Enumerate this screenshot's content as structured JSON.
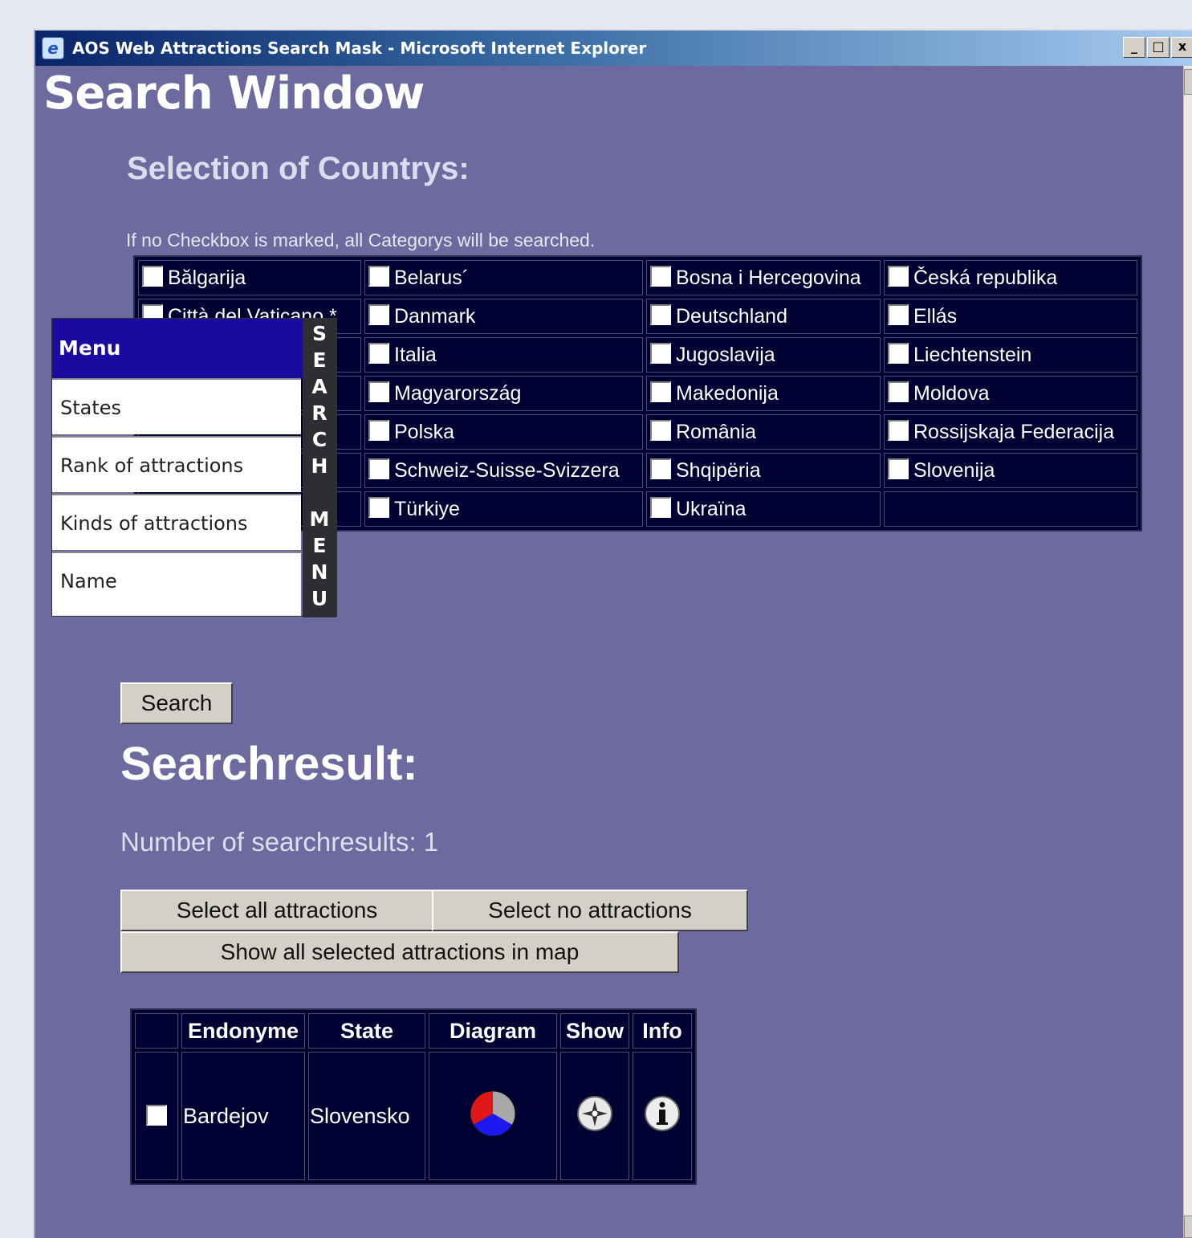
{
  "window": {
    "title": "AOS Web Attractions Search Mask - Microsoft Internet Explorer",
    "controls": [
      "_",
      "□",
      "x"
    ]
  },
  "page": {
    "title": "Search Window",
    "section_title": "Selection of Countrys:",
    "hint": "If no Checkbox is marked, all Categorys will be searched."
  },
  "countries": {
    "rows": [
      [
        "Bălgarija",
        "Belarus´",
        "Bosna i Hercegovina",
        "Česká republika"
      ],
      [
        "Città del Vaticano *",
        "Danmark",
        "Deutschland",
        "Ellás"
      ],
      [
        "",
        "Italia",
        "Jugoslavija",
        "Liechtenstein"
      ],
      [
        "",
        "Magyarország",
        "Makedonija",
        "Moldova"
      ],
      [
        "",
        "Polska",
        "România",
        "Rossijskaja Federacija"
      ],
      [
        "",
        "Schweiz-Suisse-Svizzera",
        "Shqipëria",
        "Slovenija"
      ],
      [
        "",
        "Türkiye",
        "Ukraïna",
        ""
      ]
    ]
  },
  "menu": {
    "header": "Menu",
    "items": [
      "States",
      "Rank of attractions",
      "Kinds of attractions",
      "Name"
    ],
    "tab_letters": [
      "S",
      "E",
      "A",
      "R",
      "C",
      "H",
      "",
      "M",
      "E",
      "N",
      "U"
    ]
  },
  "search_button": "Search",
  "results": {
    "title": "Searchresult:",
    "count_text": "Number of searchresults: 1",
    "select_all": "Select all attractions",
    "select_none": "Select no attractions",
    "show_in_map": "Show all selected attractions in map",
    "columns": [
      "",
      "Endonyme",
      "State",
      "Diagram",
      "Show",
      "Info"
    ],
    "rows": [
      {
        "endonyme": "Bardejov",
        "state": "Slovensko",
        "diagram_icon": "pie-chart-icon",
        "show_icon": "compass-icon",
        "info_icon": "info-icon"
      }
    ]
  },
  "colors": {
    "page_bg": "#6c6a9f",
    "table_cell": "#000033",
    "menu_header": "#1a0aa0"
  }
}
